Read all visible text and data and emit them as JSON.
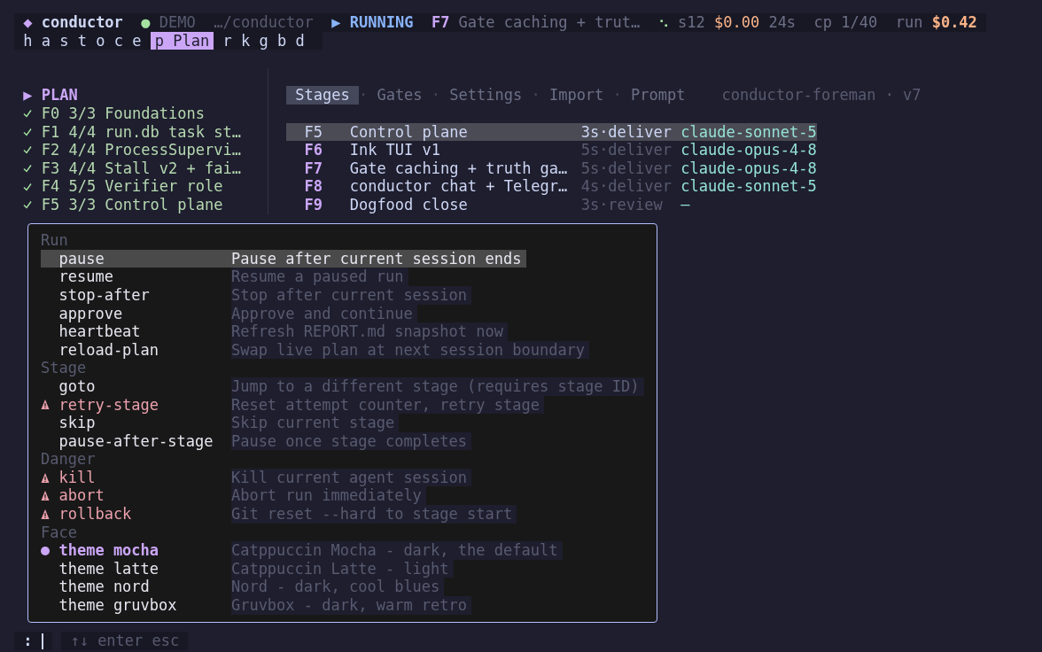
{
  "header": {
    "logo": "◆",
    "title": "conductor",
    "mode_dot": "●",
    "mode": "DEMO",
    "path": "…/conductor",
    "status_icon": "▶",
    "status": "RUNNING",
    "stage_id": "F7",
    "stage_title": "Gate caching + trut…",
    "spinner": "⠢",
    "session": "s12",
    "session_cost": "$0.00",
    "elapsed": "24s",
    "checkpoint": "cp 1/40",
    "run_label": "run",
    "run_cost": "$0.42"
  },
  "nav_keys": [
    {
      "key": "h",
      "selected": false
    },
    {
      "key": "a",
      "selected": false
    },
    {
      "key": "s",
      "selected": false
    },
    {
      "key": "t",
      "selected": false
    },
    {
      "key": "o",
      "selected": false
    },
    {
      "key": "c",
      "selected": false
    },
    {
      "key": "e",
      "selected": false
    },
    {
      "key": "p",
      "label": "Plan",
      "selected": true
    },
    {
      "key": "r",
      "selected": false
    },
    {
      "key": "k",
      "selected": false
    },
    {
      "key": "g",
      "selected": false
    },
    {
      "key": "b",
      "selected": false
    },
    {
      "key": "d",
      "selected": false
    }
  ],
  "plan": {
    "marker": "▶",
    "title": "PLAN",
    "items": [
      {
        "done": true,
        "text": "F0 3/3 Foundations"
      },
      {
        "done": true,
        "text": "F1 4/4 run.db task st…"
      },
      {
        "done": true,
        "text": "F2 4/4 ProcessSupervi…"
      },
      {
        "done": true,
        "text": "F3 4/4 Stall v2 + fai…"
      },
      {
        "done": true,
        "text": "F4 5/5 Verifier role"
      },
      {
        "done": true,
        "text": "F5 3/3 Control plane"
      }
    ]
  },
  "tabs": [
    {
      "label": "Stages",
      "selected": true
    },
    {
      "label": "Gates",
      "selected": false
    },
    {
      "label": "Settings",
      "selected": false
    },
    {
      "label": "Import",
      "selected": false
    },
    {
      "label": "Prompt",
      "selected": false
    }
  ],
  "tab_separator": "·",
  "project": "conductor-foreman · v7",
  "stages": [
    {
      "id": "F5",
      "title": "Control plane",
      "timing": "3s·deliver",
      "model": "claude-sonnet-5",
      "selected": true
    },
    {
      "id": "F6",
      "title": "Ink TUI v1",
      "timing": "5s·deliver",
      "model": "claude-opus-4-8",
      "selected": false
    },
    {
      "id": "F7",
      "title": "Gate caching + truth ga…",
      "timing": "5s·deliver",
      "model": "claude-opus-4-8",
      "selected": false
    },
    {
      "id": "F8",
      "title": "conductor chat + Telegr…",
      "timing": "4s·deliver",
      "model": "claude-sonnet-5",
      "selected": false
    },
    {
      "id": "F9",
      "title": "Dogfood close",
      "timing": "3s·review",
      "model": "—",
      "selected": false
    }
  ],
  "palette": {
    "groups": [
      {
        "name": "Run",
        "commands": [
          {
            "kind": "plain",
            "name": "pause",
            "description": "Pause after current session ends",
            "selected": true
          },
          {
            "kind": "plain",
            "name": "resume",
            "description": "Resume a paused run",
            "selected": false
          },
          {
            "kind": "plain",
            "name": "stop-after",
            "description": "Stop after current session",
            "selected": false
          },
          {
            "kind": "plain",
            "name": "approve",
            "description": "Approve and continue",
            "selected": false
          },
          {
            "kind": "plain",
            "name": "heartbeat",
            "description": "Refresh REPORT.md snapshot now",
            "selected": false
          },
          {
            "kind": "plain",
            "name": "reload-plan",
            "description": "Swap live plan at next session boundary",
            "selected": false
          }
        ]
      },
      {
        "name": "Stage",
        "commands": [
          {
            "kind": "plain",
            "name": "goto",
            "description": "Jump to a different stage (requires stage ID)",
            "selected": false
          },
          {
            "kind": "danger",
            "name": "retry-stage",
            "description": "Reset attempt counter, retry stage",
            "selected": false
          },
          {
            "kind": "plain",
            "name": "skip",
            "description": "Skip current stage",
            "selected": false
          },
          {
            "kind": "plain",
            "name": "pause-after-stage",
            "description": "Pause once stage completes",
            "selected": false
          }
        ]
      },
      {
        "name": "Danger",
        "commands": [
          {
            "kind": "danger",
            "name": "kill",
            "description": "Kill current agent session",
            "selected": false
          },
          {
            "kind": "danger",
            "name": "abort",
            "description": "Abort run immediately",
            "selected": false
          },
          {
            "kind": "danger",
            "name": "rollback",
            "description": "Git reset --hard to stage start",
            "selected": false
          }
        ]
      },
      {
        "name": "Face",
        "commands": [
          {
            "kind": "theme",
            "active": true,
            "name": "theme mocha",
            "description": "Catppuccin Mocha - dark, the default",
            "selected": false
          },
          {
            "kind": "theme",
            "active": false,
            "name": "theme latte",
            "description": "Catppuccin Latte - light",
            "selected": false
          },
          {
            "kind": "theme",
            "active": false,
            "name": "theme nord",
            "description": "Nord - dark, cool blues",
            "selected": false
          },
          {
            "kind": "theme",
            "active": false,
            "name": "theme gruvbox",
            "description": "Gruvbox - dark, warm retro",
            "selected": false
          }
        ]
      }
    ]
  },
  "prompt": {
    "prefix": ":",
    "hint": "↑↓ enter esc"
  }
}
